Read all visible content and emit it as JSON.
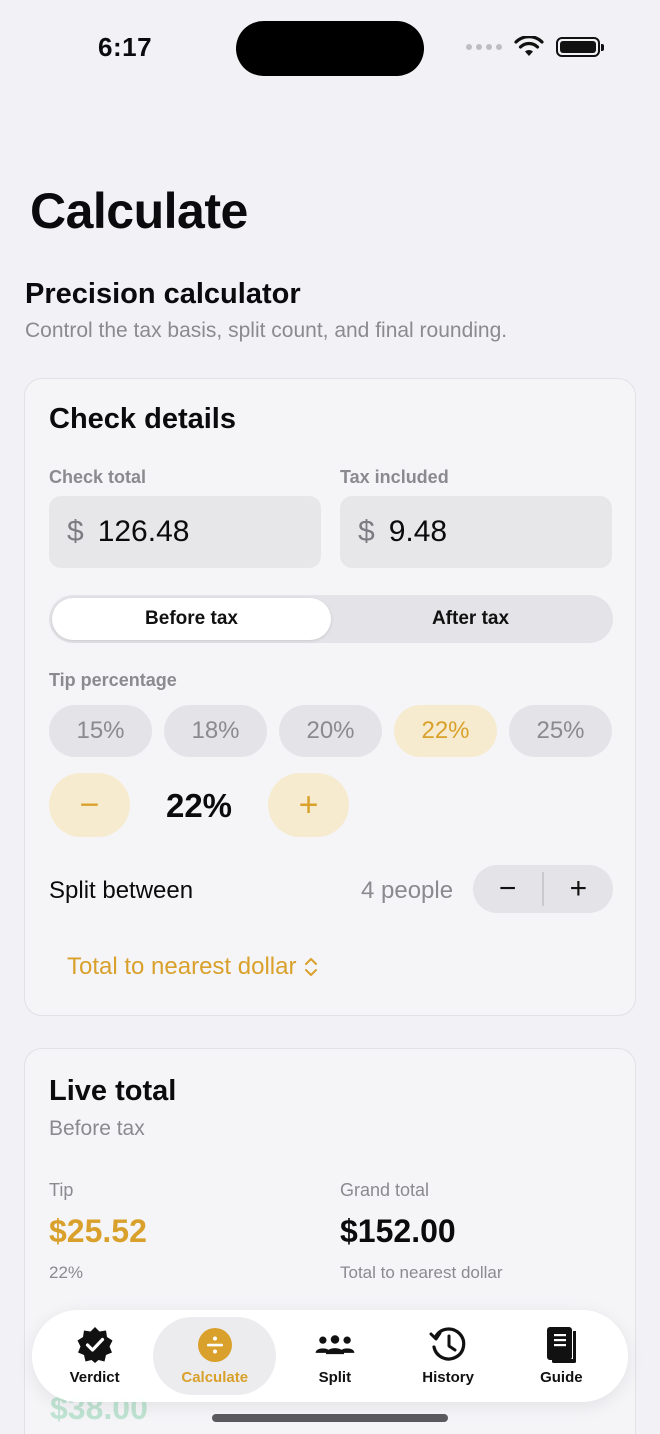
{
  "status_bar": {
    "time": "6:17"
  },
  "page": {
    "title": "Calculate"
  },
  "intro": {
    "title": "Precision calculator",
    "subtitle": "Control the tax basis, split count, and final rounding."
  },
  "check_details": {
    "title": "Check details",
    "check_total": {
      "label": "Check total",
      "currency": "$",
      "value": "126.48"
    },
    "tax_included": {
      "label": "Tax included",
      "currency": "$",
      "value": "9.48"
    },
    "tax_basis": {
      "options": [
        "Before tax",
        "After tax"
      ],
      "selected": "Before tax"
    },
    "tip": {
      "label": "Tip percentage",
      "presets": [
        "15%",
        "18%",
        "20%",
        "22%",
        "25%"
      ],
      "selected": "22%",
      "value": "22%",
      "decrement": "−",
      "increment": "+"
    },
    "split": {
      "label": "Split between",
      "count": "4 people",
      "decrement": "−",
      "increment": "+"
    },
    "rounding": {
      "label": "Total to nearest dollar"
    }
  },
  "live_total": {
    "title": "Live total",
    "basis": "Before tax",
    "tip": {
      "label": "Tip",
      "value": "$25.52",
      "percent": "22%"
    },
    "grand_total": {
      "label": "Grand total",
      "value": "$152.00",
      "note": "Total to nearest dollar"
    },
    "peek_value": "$38.00"
  },
  "tab_bar": {
    "tabs": [
      {
        "label": "Verdict",
        "icon": "verdict-badge-icon"
      },
      {
        "label": "Calculate",
        "icon": "divide-icon"
      },
      {
        "label": "Split",
        "icon": "people-icon"
      },
      {
        "label": "History",
        "icon": "history-clock-icon"
      },
      {
        "label": "Guide",
        "icon": "book-icon"
      }
    ],
    "active": "Calculate"
  },
  "colors": {
    "accent": "#d9a12b",
    "accent_soft": "#f6ebcf",
    "background": "#f2f2f6",
    "muted_text": "#8a8a8f",
    "success_soft": "#bfe3d2"
  }
}
